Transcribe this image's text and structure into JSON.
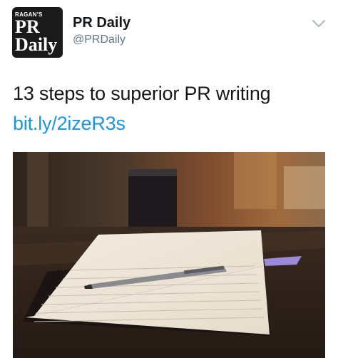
{
  "tweet": {
    "avatar": {
      "small_text": "RAGAN'S",
      "line1": "PR",
      "line2": "Daily"
    },
    "author_name": "PR Daily",
    "author_handle": "@PRDaily",
    "menu_icon": "chevron-down-icon",
    "text": "13 steps to superior PR writing",
    "link_text": "bit.ly/2izeR3s",
    "media_description_icon": "photo"
  },
  "colors": {
    "text": "#14171a",
    "secondary": "#657786",
    "link": "#1b95e0",
    "chevron": "#aab8c2"
  }
}
